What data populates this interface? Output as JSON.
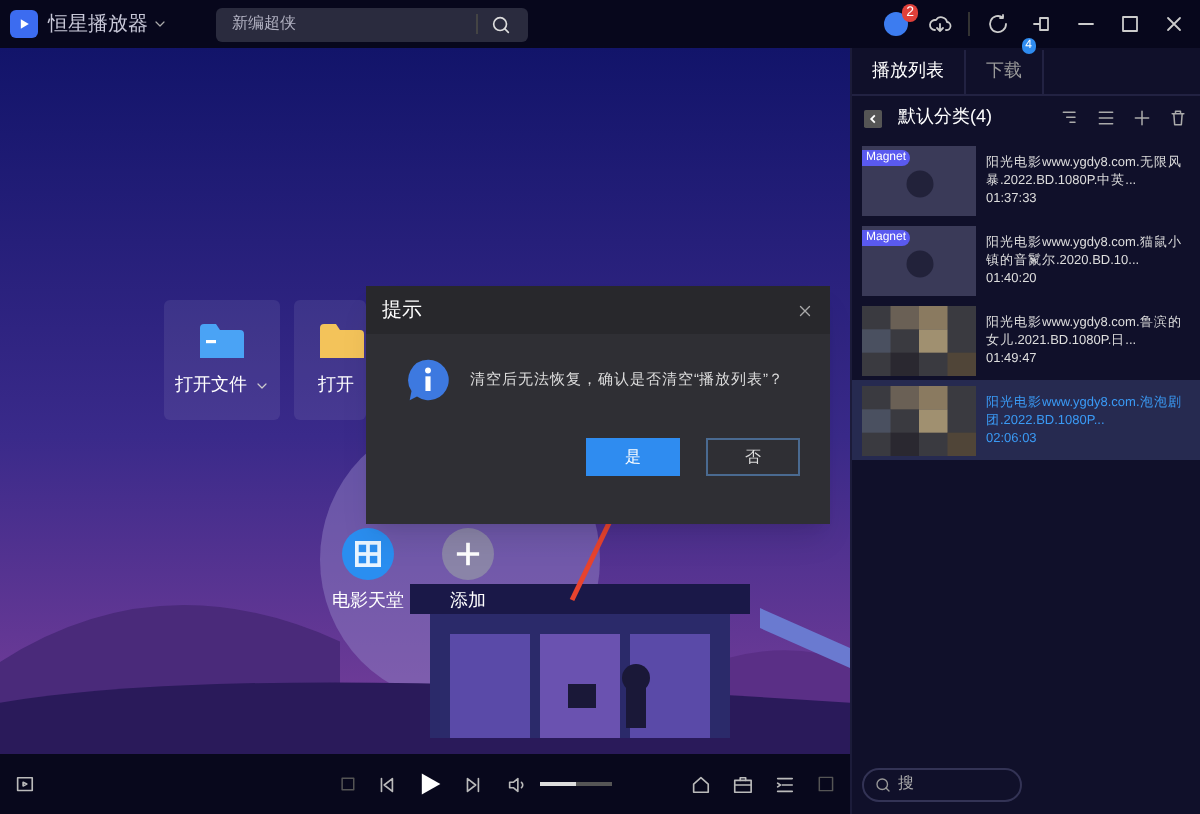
{
  "app": {
    "title": "恒星播放器"
  },
  "search": {
    "placeholder": "新编超侠"
  },
  "notifications": {
    "badge": "2"
  },
  "launcher": [
    {
      "label": "打开文件",
      "kind": "file"
    },
    {
      "label": "打开",
      "kind": "folder"
    }
  ],
  "shortcuts": [
    {
      "label": "电影天堂",
      "kind": "film"
    },
    {
      "label": "添加",
      "kind": "add"
    }
  ],
  "dialog": {
    "title": "提示",
    "message": "清空后无法恢复，确认是否清空“播放列表”？",
    "buttons": [
      {
        "label": "是",
        "primary": true
      },
      {
        "label": "否",
        "primary": false
      }
    ]
  },
  "tabs": [
    {
      "label": "播放列表",
      "selected": true
    },
    {
      "label": "下载",
      "selected": false,
      "badge": "4"
    }
  ],
  "playlist": {
    "category": "默认分类(4)",
    "items": [
      {
        "title": "阳光电影www.ygdy8.com.无限风暴.2022.BD.1080P.中英...",
        "duration": "01:37:33",
        "badge": "Magnet",
        "selected": false
      },
      {
        "title": "阳光电影www.ygdy8.com.猫鼠小镇的音鬣尔.2020.BD.10...",
        "duration": "01:40:20",
        "badge": "Magnet",
        "selected": false
      },
      {
        "title": "阳光电影www.ygdy8.com.鲁滨的女儿.2021.BD.1080P.日...",
        "duration": "01:49:47",
        "selected": false
      },
      {
        "title": "阳光电影www.ygdy8.com.泡泡剧团.2022.BD.1080P...",
        "duration": "02:06:03",
        "selected": true
      }
    ]
  },
  "player": {
    "volume": {
      "level": 0.5
    }
  },
  "panel_search": {
    "placeholder": "搜"
  }
}
